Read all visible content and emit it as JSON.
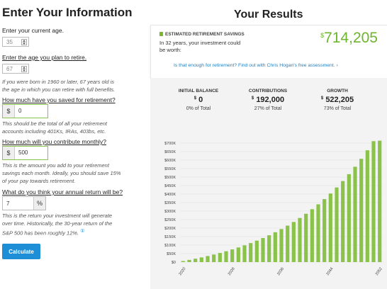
{
  "form": {
    "title": "Enter Your Information",
    "current_age_label": "Enter your current age.",
    "current_age_value": "35",
    "retire_age_label": "Enter the age you plan to retire.",
    "retire_age_value": "67",
    "retire_age_help": "If you were born in 1960 or later, 67 years old is the age in which you can retire with full benefits.",
    "saved_label": "How much have you saved for retirement?",
    "saved_value": "0",
    "saved_help": "This should be the total of all your retirement accounts including 401Ks, IRAs, 403bs, etc.",
    "monthly_label": "How much will you contribute monthly?",
    "monthly_value": "500",
    "monthly_help": "This is the amount you add to your retirement savings each month. Ideally, you should save 15% of your pay towards retirement.",
    "return_label": "What do you think your annual return will be?",
    "return_value": "7",
    "return_help": "This is the return your investment will generate over time. Historically, the 30-year return of the S&P 500 has been roughly 12%.",
    "currency_symbol": "$",
    "percent_symbol": "%",
    "calculate_label": "Calculate"
  },
  "results": {
    "title": "Your Results",
    "savings_caption": "ESTIMATED RETIREMENT SAVINGS",
    "savings_desc": "In 32 years, your investment could be worth:",
    "savings_currency": "$",
    "savings_value": "714,205",
    "link_text": "Is that enough for retirement? Find out with Chris Hogan's free assessment. ›",
    "stats": [
      {
        "heading": "INITIAL BALANCE",
        "currency": "$",
        "value": "0",
        "percent": "0% of Total"
      },
      {
        "heading": "CONTRIBUTIONS",
        "currency": "$",
        "value": "192,000",
        "percent": "27% of Total"
      },
      {
        "heading": "GROWTH",
        "currency": "$",
        "value": "522,205",
        "percent": "73% of Total"
      }
    ]
  },
  "colors": {
    "accent_green": "#7ab82a",
    "button_blue": "#1e8fd6",
    "link_blue": "#1e7fc0"
  },
  "chart_data": {
    "type": "bar",
    "categories": [
      2020,
      2021,
      2022,
      2023,
      2024,
      2025,
      2026,
      2027,
      2028,
      2029,
      2030,
      2031,
      2032,
      2033,
      2034,
      2035,
      2036,
      2037,
      2038,
      2039,
      2040,
      2041,
      2042,
      2043,
      2044,
      2045,
      2046,
      2047,
      2048,
      2049,
      2050,
      2051,
      2052
    ],
    "x_tick_labels": [
      "2020",
      "2028",
      "2036",
      "2044",
      "2052"
    ],
    "values": [
      6174,
      12795,
      19894,
      27505,
      35667,
      44418,
      53802,
      63864,
      74653,
      86222,
      98627,
      111929,
      126192,
      141486,
      157885,
      175470,
      194325,
      214544,
      236224,
      259471,
      284397,
      311125,
      339783,
      370512,
      403462,
      438792,
      476676,
      517297,
      560854,
      607559,
      657638,
      711338,
      714205
    ],
    "ylim": [
      0,
      700000
    ],
    "y_tick_labels": [
      "$0",
      "$50K",
      "$100K",
      "$150K",
      "$200K",
      "$250K",
      "$300K",
      "$350K",
      "$400K",
      "$450K",
      "$500K",
      "$550K",
      "$600K",
      "$650K",
      "$700K"
    ],
    "grid": true,
    "color": "#8bc34a"
  }
}
